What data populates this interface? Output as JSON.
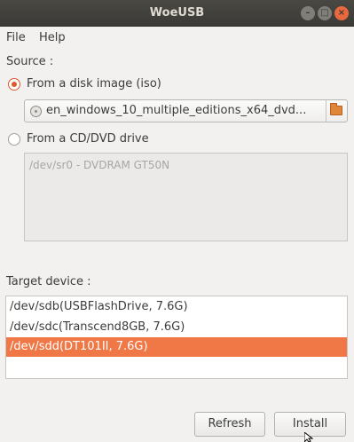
{
  "window": {
    "title": "WoeUSB"
  },
  "menubar": {
    "items": [
      "File",
      "Help"
    ]
  },
  "source": {
    "label": "Source :",
    "disk_image_option": "From a disk image (iso)",
    "file_chooser_value": "en_windows_10_multiple_editions_x64_dvd...",
    "cd_option": "From a CD/DVD drive",
    "cd_drives": [
      "/dev/sr0 - DVDRAM GT50N"
    ]
  },
  "target": {
    "label": "Target device :",
    "devices": [
      "/dev/sdb(USBFlashDrive, 7.6G)",
      "/dev/sdc(Transcend8GB, 7.6G)",
      "/dev/sdd(DT101II, 7.6G)"
    ],
    "selected_index": 2
  },
  "buttons": {
    "refresh": "Refresh",
    "install": "Install"
  },
  "colors": {
    "accent": "#f07746",
    "titlebar": "#3b3a36",
    "window_bg": "#f2f1f0"
  }
}
